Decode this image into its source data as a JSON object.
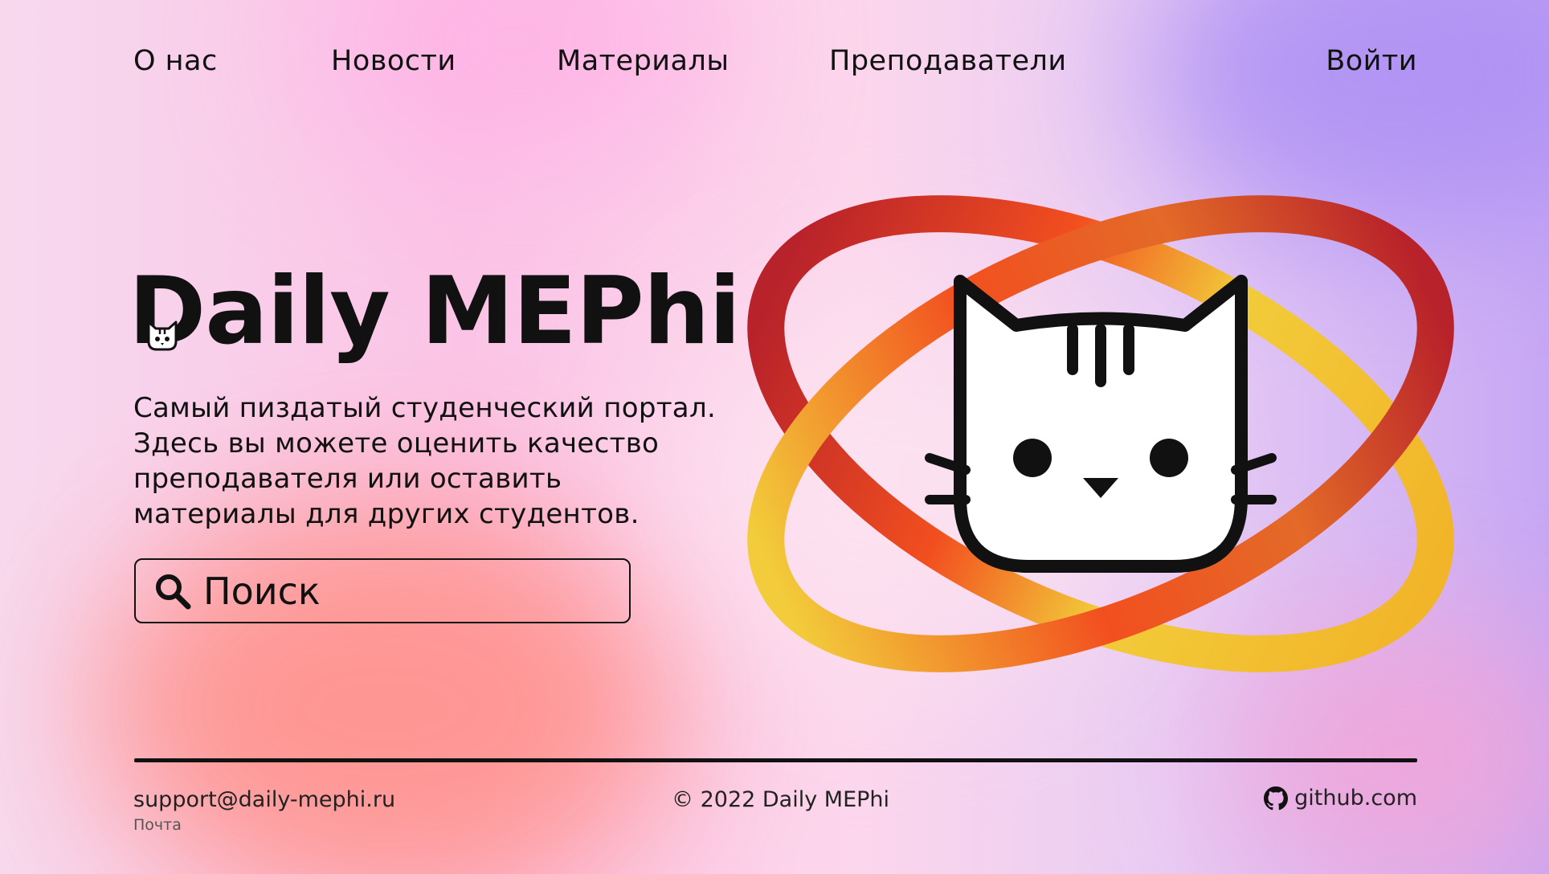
{
  "nav": {
    "about": "О нас",
    "news": "Новости",
    "materials": "Материалы",
    "teachers": "Преподаватели",
    "login": "Войти"
  },
  "hero": {
    "title": "Daily MEPhi",
    "description_lines": [
      "Самый пиздатый студенческий портал.",
      "Здесь вы можете оценить качество",
      "преподавателя или оставить",
      "материалы для других студентов."
    ]
  },
  "search": {
    "label": "Поиск",
    "icon": "search-icon"
  },
  "logo": {
    "icon": "cat-atom-logo",
    "colors": {
      "ring_start": "#b8222a",
      "ring_mid": "#f24f1f",
      "ring_end": "#f2cc3a"
    }
  },
  "footer": {
    "email": "support@daily-mephi.ru",
    "email_caption": "Почта",
    "copyright": "© 2022 Daily MEPhi",
    "github": "github.com",
    "github_icon": "github-icon"
  }
}
